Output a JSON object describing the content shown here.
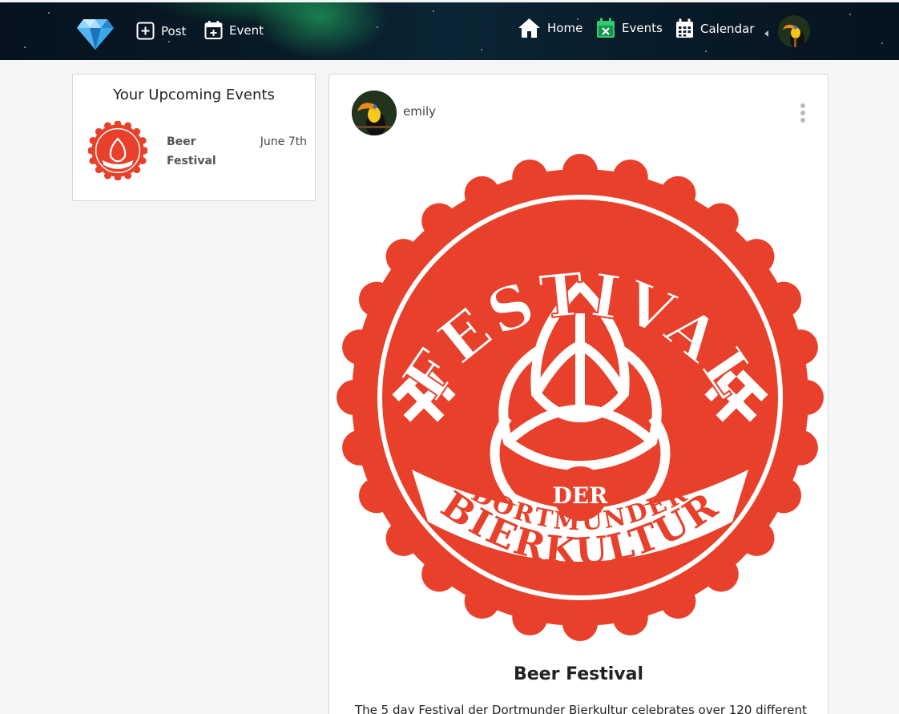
{
  "nav": {
    "post_label": "Post",
    "event_label": "Event",
    "home_label": "Home",
    "events_label": "Events",
    "calendar_label": "Calendar",
    "icons": {
      "logo": "diamond-icon",
      "post": "plus-square-icon",
      "event": "calendar-plus-icon",
      "home": "home-icon",
      "events": "calendar-x-icon",
      "calendar": "calendar-grid-icon",
      "avatar": "toucan-avatar"
    },
    "colors": {
      "events_icon": "#2ecc71",
      "icon_default": "#ffffff"
    }
  },
  "upcoming": {
    "title": "Your Upcoming Events",
    "events": [
      {
        "name": "Beer Festival",
        "date": "June 7th"
      }
    ]
  },
  "post": {
    "username": "emily",
    "image_text": {
      "top": "FESTIVAL",
      "middle": "DER",
      "lower1": "DORTMUNDER",
      "lower2": "BIERKULTUR"
    },
    "title": "Beer Festival",
    "description": "The 5 day Festival der Dortmunder Bierkultur celebrates over 120 different",
    "colors": {
      "badge_red": "#e8402a",
      "badge_white": "#ffffff"
    }
  }
}
